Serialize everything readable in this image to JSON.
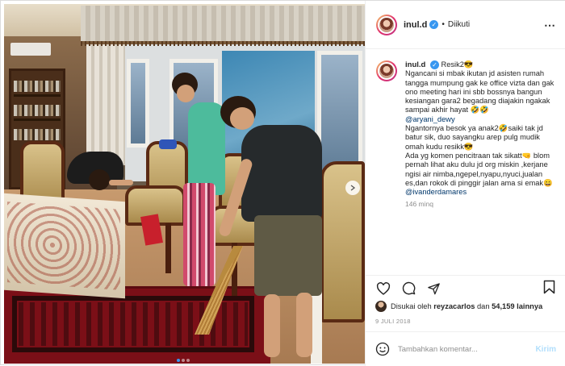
{
  "post": {
    "username": "inul.d",
    "verified_mark": "✓",
    "separator": "•",
    "follow_status": "Diikuti",
    "more_icon": "⋯",
    "caption": {
      "username": "inul.d",
      "line1": "Resik2😎",
      "text1": "Ngancani si mbak ikutan jd asisten rumah tangga mumpung gak ke office vizta dan gak ono meeting hari ini sbb bossnya bangun kesiangan gara2 begadang diajakin ngakak sampai akhir hayat 🤣🤣",
      "mention1": "@aryani_dewy",
      "text2": "Ngantornya besok ya anak2🤣saiki tak jd batur sik, duo sayangku arep pulg mudik omah kudu resikk😎",
      "text3": "Ada yg komen pencitraan tak sikatt🤜 blom pernah lihat aku dulu jd org miskin ,kerjane ngisi air nimba,ngepel,nyapu,nyuci,jualan es,dan rokok di pinggir jalan ama si emak😄",
      "mention2": "@ivanderdamares",
      "time": "146 minq"
    },
    "likes": {
      "prefix": "Disukai oleh",
      "user": "reyzacarlos",
      "conjunction": "dan",
      "count": "54,159 lainnya"
    },
    "date": "9 JULI 2018",
    "comment_box": {
      "placeholder": "Tambahkan komentar...",
      "send_label": "Kirim",
      "emoji_icon": "smiley-icon"
    }
  },
  "carousel": {
    "slides": 3,
    "active_slide": 1
  },
  "colors": {
    "verified": "#3897f0",
    "mention": "#00376b",
    "muted": "#8e8e8e",
    "send": "#b2dffc"
  }
}
